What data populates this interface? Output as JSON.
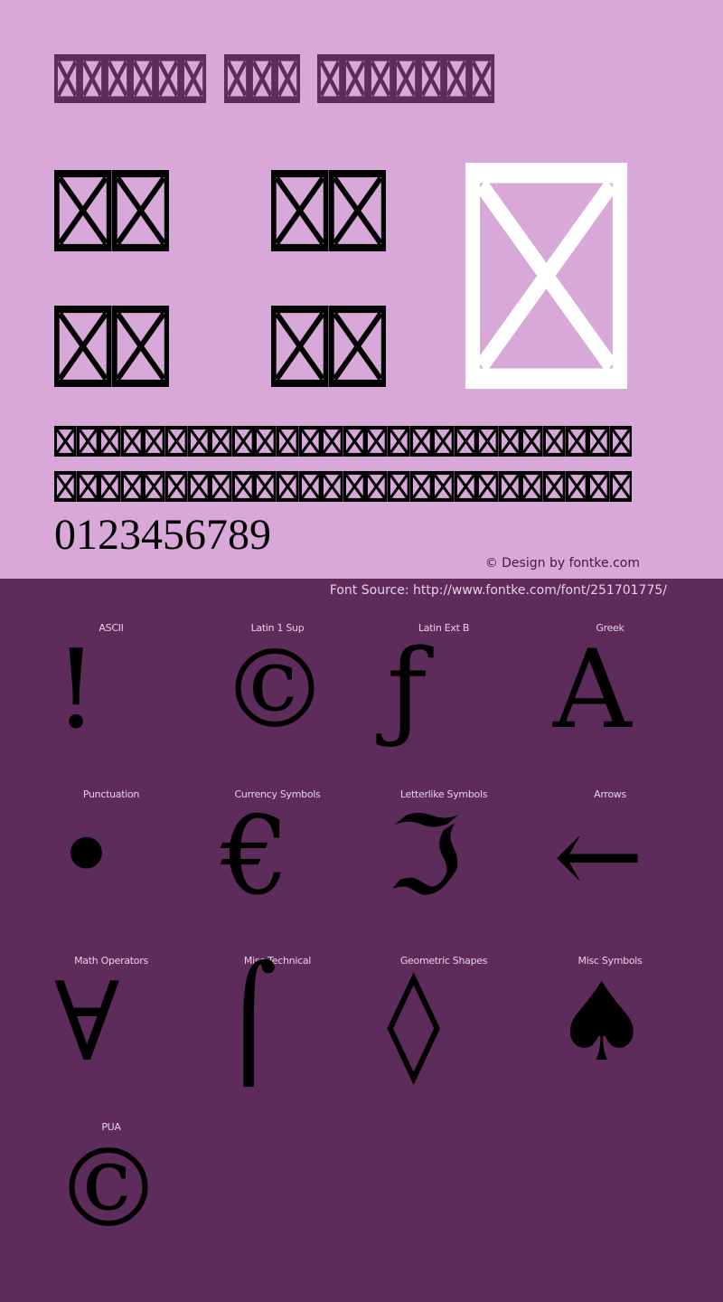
{
  "colors": {
    "top_background": "#d8a8d8",
    "bottom_background": "#5e2c5a",
    "title_glyph": "#5e2c5a",
    "sample_glyph": "#000000",
    "big_glyph": "#ffffff",
    "label_text": "#e8d0e6"
  },
  "header": {
    "title_words_glyph_counts": [
      6,
      3,
      7
    ],
    "title_glyph_icon": "missing-glyph-box-icon"
  },
  "samples": {
    "pairs_count": 4,
    "big_glyph_icon": "missing-glyph-box-icon",
    "uppercase_line_glyph_count": 26,
    "lowercase_line_glyph_count": 26,
    "digits": "0123456789"
  },
  "credit": "© Design by fontke.com",
  "source": "Font Source: http://www.fontke.com/font/251701775/",
  "glyph_grid": [
    {
      "label": "ASCII",
      "glyph": "!"
    },
    {
      "label": "Latin 1 Sup",
      "glyph": "©"
    },
    {
      "label": "Latin Ext B",
      "glyph": "ƒ"
    },
    {
      "label": "Greek",
      "glyph": "Α"
    },
    {
      "label": "Punctuation",
      "glyph": "•"
    },
    {
      "label": "Currency Symbols",
      "glyph": "€"
    },
    {
      "label": "Letterlike Symbols",
      "glyph": "ℑ"
    },
    {
      "label": "Arrows",
      "glyph": "←"
    },
    {
      "label": "Math Operators",
      "glyph": "∀"
    },
    {
      "label": "Misc Technical",
      "glyph": "⌠"
    },
    {
      "label": "Geometric Shapes",
      "glyph": "◊"
    },
    {
      "label": "Misc Symbols",
      "glyph": "♠"
    },
    {
      "label": "PUA",
      "glyph": "©"
    }
  ]
}
